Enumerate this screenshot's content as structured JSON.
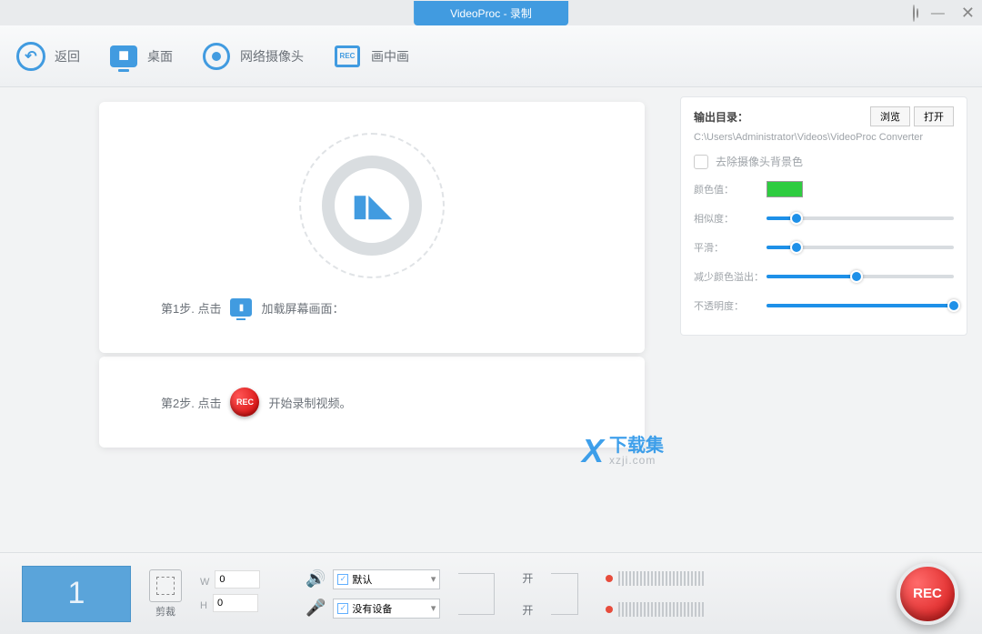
{
  "title": "VideoProc - 录制",
  "toolbar": {
    "back": "返回",
    "desktop": "桌面",
    "webcam": "网络摄像头",
    "pip": "画中画",
    "pip_icon_text": "REC"
  },
  "steps": {
    "s1_prefix": "第1步. 点击",
    "s1_suffix": "加载屏幕画面：",
    "s2_prefix": "第2步. 点击",
    "s2_suffix": "开始录制视频。",
    "rec_small": "REC"
  },
  "settings": {
    "out_label": "输出目录：",
    "browse": "浏览",
    "open": "打开",
    "path": "C:\\Users\\Administrator\\Videos\\VideoProc Converter",
    "remove_bg": "去除摄像头背景色",
    "color_label": "颜色值：",
    "similarity_label": "相似度：",
    "similarity_pct": 16,
    "smooth_label": "平滑：",
    "smooth_pct": 16,
    "spill_label": "减少颜色溢出：",
    "spill_pct": 48,
    "opacity_label": "不透明度：",
    "opacity_pct": 100
  },
  "bottom": {
    "thumb_count": "1",
    "crop": "剪裁",
    "w_label": "W",
    "h_label": "H",
    "w_val": "0",
    "h_val": "0",
    "speaker_sel": "默认",
    "mic_sel": "没有设备",
    "toggle_on": "开",
    "rec": "REC"
  },
  "watermark": {
    "brand": "下载集",
    "url": "xzji.com"
  }
}
